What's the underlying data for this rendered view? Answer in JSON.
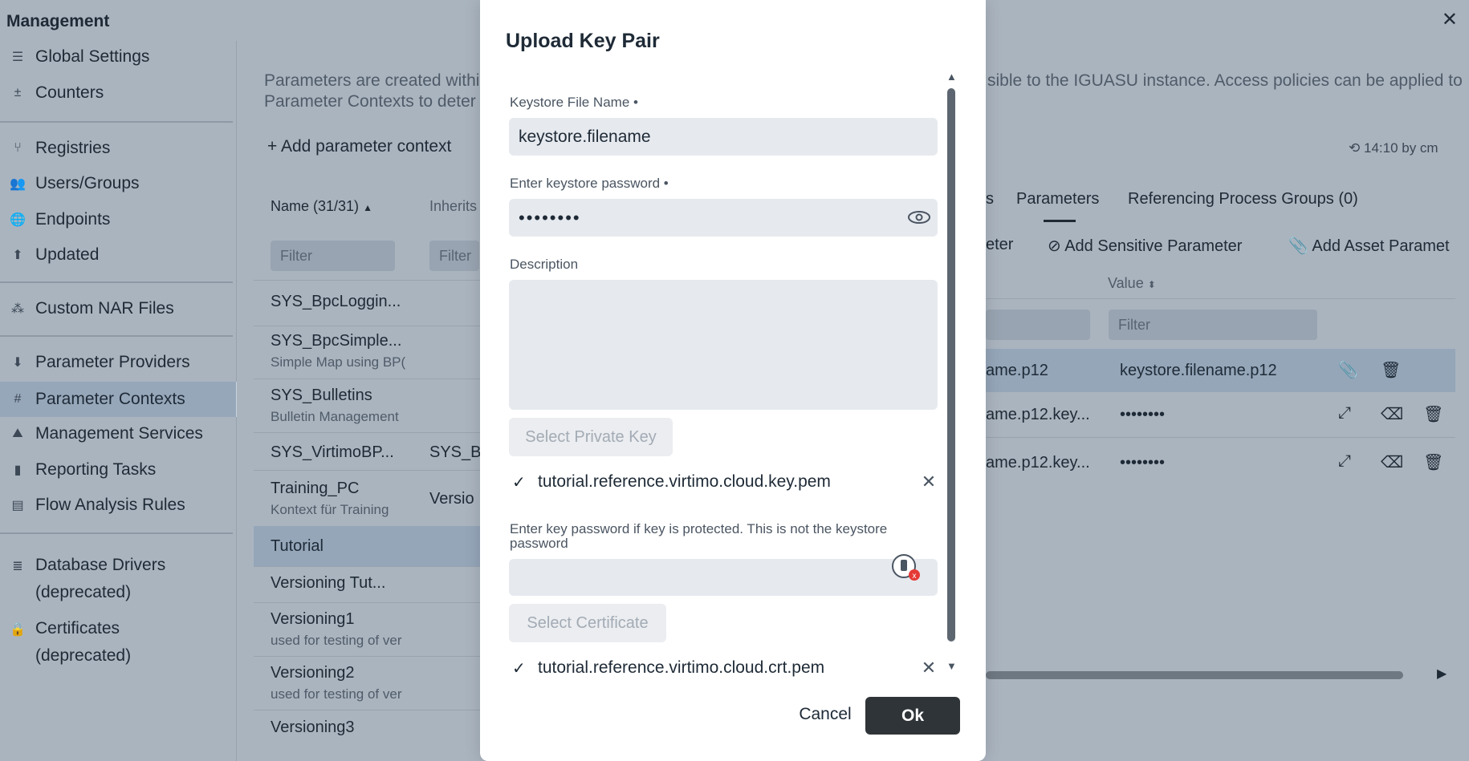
{
  "window": {
    "title": "Management",
    "close_glyph": "✕"
  },
  "sidebar": {
    "items": [
      {
        "icon": "sliders-icon",
        "glyph": "☰",
        "label": "Global Settings"
      },
      {
        "icon": "plus-minus-icon",
        "glyph": "±",
        "label": "Counters"
      },
      {
        "icon": "branch-icon",
        "glyph": "⑂",
        "label": "Registries"
      },
      {
        "icon": "users-icon",
        "glyph": "👥",
        "label": "Users/Groups"
      },
      {
        "icon": "globe-icon",
        "glyph": "🌐",
        "label": "Endpoints"
      },
      {
        "icon": "arrow-circle-icon",
        "glyph": "⬆",
        "label": "Updated"
      },
      {
        "icon": "nar-icon",
        "glyph": "⁂",
        "label": "Custom NAR Files"
      },
      {
        "icon": "download-circle-icon",
        "glyph": "⬇",
        "label": "Parameter Providers"
      },
      {
        "icon": "hash-icon",
        "glyph": "#",
        "label": "Parameter Contexts"
      },
      {
        "icon": "services-icon",
        "glyph": "⛰",
        "label": "Management Services"
      },
      {
        "icon": "bar-chart-icon",
        "glyph": "▮",
        "label": "Reporting Tasks"
      },
      {
        "icon": "clipboard-icon",
        "glyph": "▤",
        "label": "Flow Analysis Rules"
      },
      {
        "icon": "database-icon",
        "glyph": "≣",
        "label": "Database Drivers",
        "sub": "(deprecated)"
      },
      {
        "icon": "lock-icon",
        "glyph": "🔒",
        "label": "Certificates",
        "sub": "(deprecated)"
      }
    ]
  },
  "background": {
    "intro_line1": "Parameters are created withi",
    "intro_line1_right": "sible to the IGUASU instance. Access policies can be applied to",
    "intro_line2": "Parameter Contexts to deter",
    "add_context": "+ Add parameter context",
    "last_modified": "14:10 by cm",
    "name_header": "Name (31/31)",
    "inherits_header": "Inherits",
    "filter_placeholder": "Filter",
    "tabs": {
      "partial": "s",
      "parameters": "Parameters",
      "referencing": "Referencing Process Groups (0)"
    },
    "actions": {
      "partial": "eter",
      "sensitive": "Add Sensitive Parameter",
      "asset": "Add Asset Paramet"
    },
    "value_header": "Value",
    "contexts": [
      {
        "name": "SYS_BpcLoggin...",
        "desc": ""
      },
      {
        "name": "SYS_BpcSimple...",
        "desc": "Simple Map using BP("
      },
      {
        "name": "SYS_Bulletins",
        "desc": "Bulletin Management"
      },
      {
        "name": "SYS_VirtimoBP...",
        "desc": "",
        "inherits": "SYS_B"
      },
      {
        "name": "Training_PC",
        "desc": "Kontext für Training",
        "inherits": "Versio"
      },
      {
        "name": "Tutorial",
        "desc": ""
      },
      {
        "name": "Versioning Tut...",
        "desc": ""
      },
      {
        "name": "Versioning1",
        "desc": "used for testing of ver"
      },
      {
        "name": "Versioning2",
        "desc": "used for testing of ver"
      },
      {
        "name": "Versioning3",
        "desc": ""
      }
    ],
    "params": [
      {
        "name": "ame.p12",
        "value": "keystore.filename.p12"
      },
      {
        "name": "ame.p12.key...",
        "value": "••••••••"
      },
      {
        "name": "ame.p12.key...",
        "value": "••••••••"
      }
    ]
  },
  "modal": {
    "title": "Upload Key Pair",
    "keystore_label": "Keystore File Name •",
    "keystore_value": "keystore.filename",
    "password_label": "Enter keystore password •",
    "password_value": "••••••••",
    "description_label": "Description",
    "select_private_key": "Select Private Key",
    "private_key_file": "tutorial.reference.virtimo.cloud.key.pem",
    "key_password_label": "Enter key password if key is protected. This is not the keystore password",
    "select_certificate": "Select Certificate",
    "certificate_file": "tutorial.reference.virtimo.cloud.crt.pem",
    "cancel": "Cancel",
    "ok": "Ok"
  }
}
